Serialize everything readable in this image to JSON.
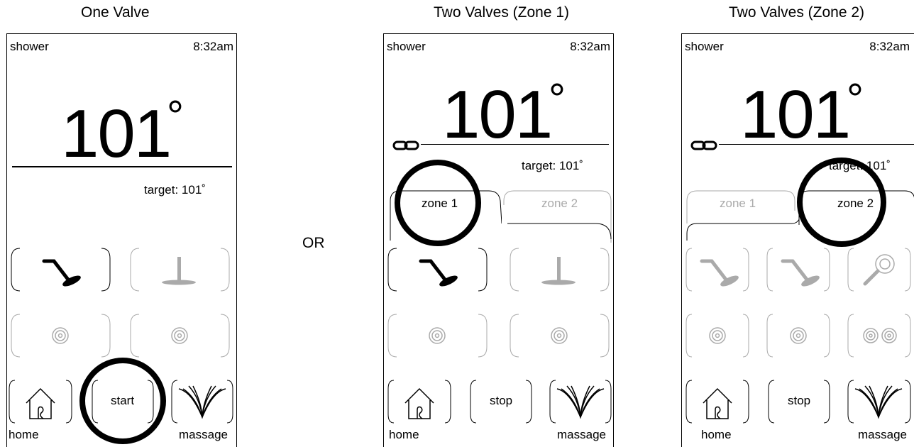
{
  "titles": {
    "one": "One Valve",
    "z1": "Two Valves (Zone 1)",
    "z2": "Two Valves (Zone 2)"
  },
  "or_label": "OR",
  "status": {
    "label": "shower",
    "time": "8:32am"
  },
  "temperature": "101",
  "degree": "°",
  "target": "target: 101˚",
  "zones": {
    "zone1": "zone 1",
    "zone2": "zone 2"
  },
  "buttons": {
    "start": "start",
    "stop": "stop"
  },
  "labels": {
    "home": "home",
    "massage": "massage"
  },
  "colors": {
    "active": "#000000",
    "inactive": "#aaaaaa",
    "highlight": "#000000"
  }
}
